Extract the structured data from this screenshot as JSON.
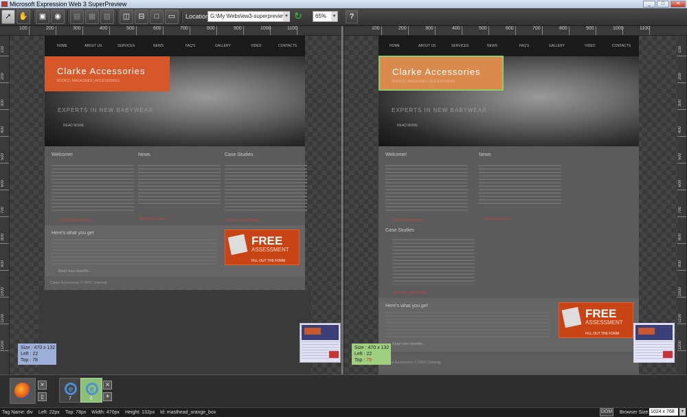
{
  "window": {
    "title": "Microsoft Expression Web 3 SuperPreview",
    "min_icon": "minimize-icon",
    "max_icon": "maximize-icon",
    "close_icon": "close-icon"
  },
  "toolbar": {
    "location_label": "Location:",
    "location_value": "G:\\My Webs\\ew3-superpreview-exar",
    "zoom_value": "65%",
    "help_label": "?",
    "tools": [
      "pointer-tool-icon",
      "pan-tool-icon",
      "single-view-icon",
      "overlay-view-icon",
      "side-by-side-vertical-icon",
      "side-by-side-horizontal-icon",
      "onion-skin-icon",
      "layout-split-vertical-icon",
      "layout-split-horizontal-icon",
      "layout-single-icon",
      "layout-overlay-icon"
    ]
  },
  "ruler_labels": [
    "100",
    "200",
    "300",
    "400",
    "500",
    "600",
    "700",
    "800",
    "900",
    "1000",
    "1100"
  ],
  "vruler_labels": [
    "100",
    "200",
    "300",
    "400",
    "500",
    "600",
    "700",
    "800",
    "900",
    "1000",
    "1100",
    "1200"
  ],
  "site": {
    "nav": [
      "HOME",
      "ABOUT US",
      "SERVICES",
      "NEWS",
      "FAQ'S",
      "GALLERY",
      "VIDEO",
      "CONTACTS"
    ],
    "brand": "Clarke Accessories",
    "brand_tag": "BOOKS | MAGAZINES | ACCESSORIES",
    "experts": "EXPERTS IN NEW BABYWEAR",
    "read_more": "READ MORE",
    "welcome": "Welcome!",
    "news": "News",
    "case_studies": "Case Studies",
    "see_authors": "See our authors list...",
    "read_news": "Read more news...",
    "see_cases": "See more case studies...",
    "here_get": "Here's what you get",
    "free": "FREE",
    "assessment": "ASSESSMENT",
    "fill_form": "FILL OUT THE FORM",
    "read_benefits": "Read more benefits...",
    "copyright": "Clarke Accessories © 2009 | Sitemap"
  },
  "left_info": {
    "size": "Size : 470 x 132",
    "left": "Left : 22",
    "top": "Top : 78"
  },
  "right_info": {
    "size": "Size : 470 x 132",
    "left": "Left : 22",
    "top_label": "Top : ",
    "top_value": "79"
  },
  "browsers": {
    "baseline_count": "",
    "ie7": "7",
    "ie6": "6",
    "close_label": "×",
    "add_label": "+"
  },
  "status": {
    "tag": "Tag Name: div",
    "left": "Left: 22px",
    "top": "Top: 78px",
    "width": "Width: 470px",
    "height": "Height: 132px",
    "id": "Id: masthead_orange_box",
    "dom": "DOM",
    "browser_size_label": "Browser Size:",
    "browser_size_value": "1024 x 768"
  }
}
